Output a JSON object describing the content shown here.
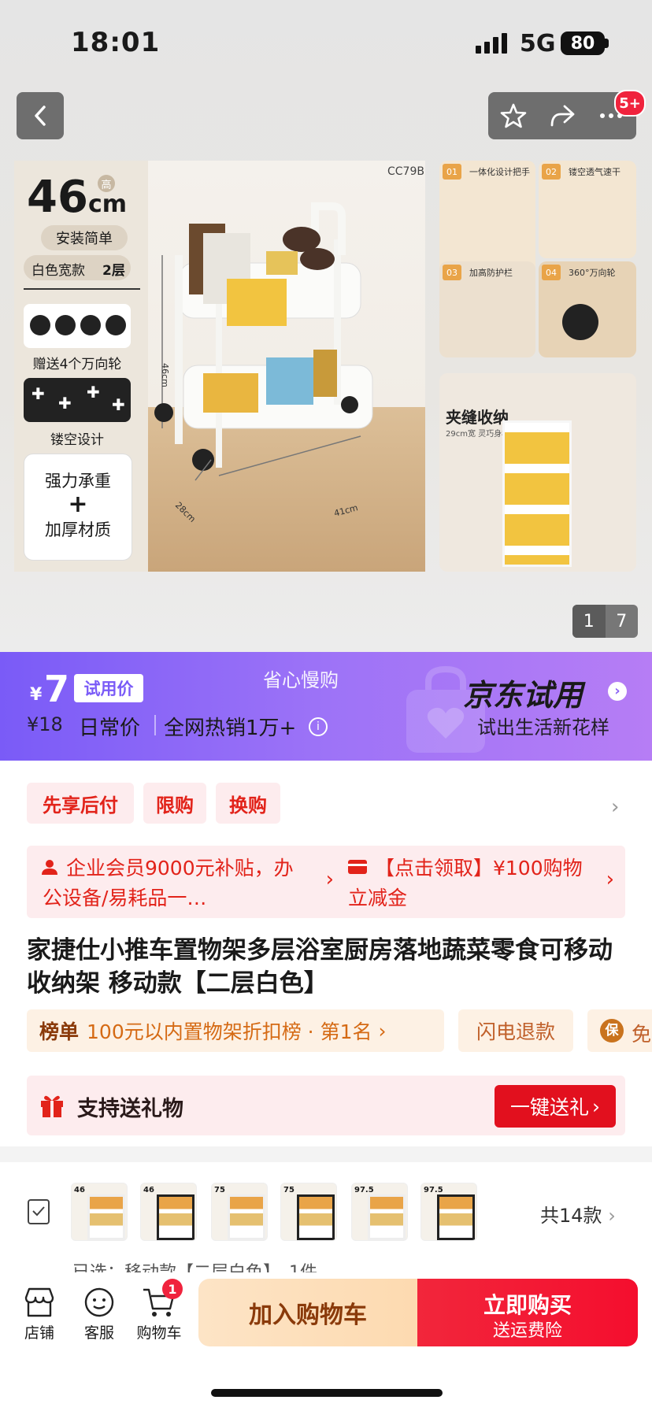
{
  "status": {
    "time": "18:01",
    "network": "5G",
    "battery": "80"
  },
  "nav": {
    "badge": "5+"
  },
  "hero": {
    "code": "CC79B",
    "size_value": "46",
    "size_unit": "cm",
    "size_tag": "高",
    "install": "安装简单",
    "version_left": "白色宽款",
    "version_right": "2层",
    "wheels_label": "赠送4个万向轮",
    "hollow_label": "镂空设计",
    "strong_line1": "强力承重",
    "strong_plus": "+",
    "strong_line2": "加厚材质",
    "dim_height": "46cm",
    "dim_depth": "28cm",
    "dim_width": "41cm",
    "grid": [
      {
        "num": "01",
        "title": "一体化设计把手"
      },
      {
        "num": "02",
        "title": "镂空透气速干"
      },
      {
        "num": "03",
        "title": "加高防护栏"
      },
      {
        "num": "04",
        "title": "360°万向轮"
      }
    ],
    "slim_title": "夹缝收纳",
    "slim_sub": "29cm宽 灵巧身材",
    "page_current": "1",
    "page_total": "7"
  },
  "promo": {
    "currency": "¥",
    "trial_price": "7",
    "trial_tag": "试用价",
    "center": "省心慢购",
    "orig_price": "¥18",
    "daily": "日常价",
    "hot": "全网热销1万+",
    "jd_title": "京东试用",
    "jd_sub": "试出生活新花样"
  },
  "chips": [
    "先享后付",
    "限购",
    "换购"
  ],
  "coupons": [
    {
      "text": "企业会员9000元补贴，办公设备/易耗品一…"
    },
    {
      "text": "【点击领取】¥100购物立减金"
    }
  ],
  "product_title": "家捷仕小推车置物架多层浴室厨房落地蔬菜零食可移动收纳架 移动款【二层白色】",
  "rank": {
    "label": "榜单",
    "text": "100元以内置物架折扣榜 · 第1名"
  },
  "flash_refund": "闪电退款",
  "insure_text": "免",
  "gift": {
    "text": "支持送礼物",
    "button": "一键送礼"
  },
  "variants": {
    "sizes": [
      "46",
      "46",
      "75",
      "75",
      "97.5",
      "97.5"
    ],
    "count": "共14款",
    "selected": "已选：移动款【二层白色】，1件"
  },
  "bottom": {
    "shop": "店铺",
    "service": "客服",
    "cart": "购物车",
    "cart_count": "1",
    "add_cart": "加入购物车",
    "buy_now": "立即购买",
    "buy_sub": "送运费险"
  },
  "colors": {
    "accent_red": "#E2231A",
    "promo_purple": "#7A5BF7",
    "buy_red": "#F40E2E"
  }
}
